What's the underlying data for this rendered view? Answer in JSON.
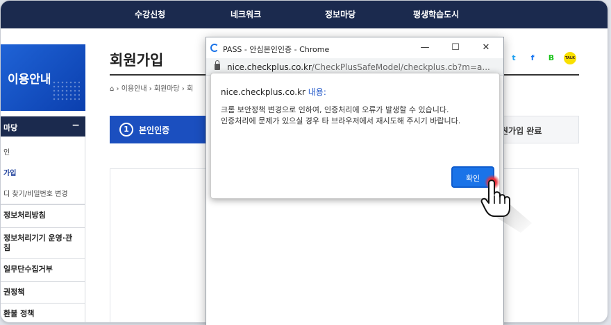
{
  "top_nav": {
    "items": [
      "수강신청",
      "네크워크",
      "정보마당",
      "평생학습도시"
    ]
  },
  "sidebar": {
    "banner_title": "이용안내",
    "section_header": "마당",
    "section_toggle": "−",
    "sub_items": [
      {
        "label": "인",
        "active": false
      },
      {
        "label": "가입",
        "active": true
      },
      {
        "label": "디 찾기/비밀번호 변경",
        "active": false
      }
    ],
    "items": [
      "정보처리방침",
      "정보처리기기 운영·관\n침",
      "일무단수집거부",
      "권정책",
      "환불 정책"
    ]
  },
  "main": {
    "page_title": "회원가입",
    "breadcrumb": [
      "이용안내",
      "회원마당",
      "회"
    ],
    "social_icons": [
      {
        "name": "twitter-icon",
        "glyph": "t",
        "color": "#1da1f2"
      },
      {
        "name": "facebook-icon",
        "glyph": "f",
        "color": "#1877f2"
      },
      {
        "name": "band-icon",
        "glyph": "B",
        "color": "#19c319"
      },
      {
        "name": "kakaotalk-icon",
        "glyph": "TALK",
        "color": "#3a1d1d",
        "bg": "#f9e000"
      }
    ],
    "steps": {
      "active_number": "1",
      "active_label": "본인인증",
      "last_label": "원가입 완료"
    }
  },
  "popup": {
    "window_title": "PASS - 안심본인인증 - Chrome",
    "window_buttons": {
      "minimize": "—",
      "maximize": "☐",
      "close": "✕"
    },
    "url_host": "nice.checkplus.co.kr",
    "url_path": "/CheckPlusSafeModel/checkplus.cb?m=a..."
  },
  "dialog": {
    "host": "nice.checkplus.co.kr",
    "heading_suffix": "내용:",
    "message_line1": "크롬 보안정책 변경으로 인하여, 인증처리에 오류가 발생할 수 있습니다.",
    "message_line2": "인증처리에 문제가 있으실 경우 타 브라우저에서 재시도해 주시기 바랍니다.",
    "ok_label": "확인"
  },
  "colors": {
    "nav_bg": "#1b2a4e",
    "primary_blue": "#1b4fbf",
    "dialog_button": "#1a73e8",
    "click_highlight": "#e8303b"
  }
}
